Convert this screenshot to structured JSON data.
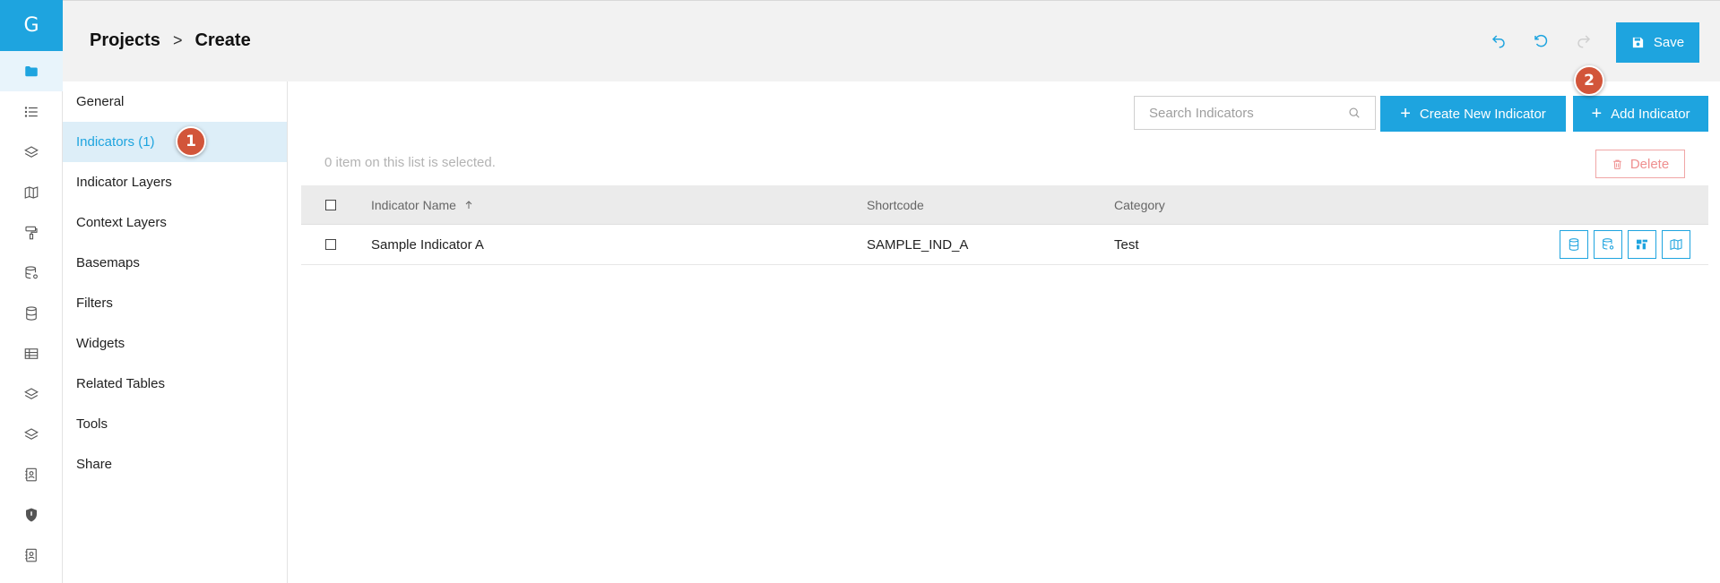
{
  "rail": {
    "logo": "G",
    "items": [
      {
        "icon": "folder-icon",
        "active": true
      },
      {
        "icon": "list-icon"
      },
      {
        "icon": "layers-icon"
      },
      {
        "icon": "map-icon"
      },
      {
        "icon": "paint-roller-icon"
      },
      {
        "icon": "database-settings-icon"
      },
      {
        "icon": "database-icon"
      },
      {
        "icon": "table-icon"
      },
      {
        "icon": "layers-icon"
      },
      {
        "icon": "layers-icon"
      },
      {
        "icon": "contact-book-icon"
      },
      {
        "icon": "shield-icon"
      },
      {
        "icon": "contact-book-icon"
      }
    ]
  },
  "header": {
    "breadcrumb": {
      "root": "Projects",
      "separator": ">",
      "current": "Create"
    },
    "save_label": "Save",
    "icons": [
      "undo-icon",
      "revert-icon",
      "redo-icon"
    ]
  },
  "submenu": {
    "items": [
      {
        "label": "General"
      },
      {
        "label": "Indicators (1)",
        "active": true,
        "badge": "1"
      },
      {
        "label": "Indicator Layers"
      },
      {
        "label": "Context Layers"
      },
      {
        "label": "Basemaps"
      },
      {
        "label": "Filters"
      },
      {
        "label": "Widgets"
      },
      {
        "label": "Related Tables"
      },
      {
        "label": "Tools"
      },
      {
        "label": "Share"
      }
    ]
  },
  "main": {
    "search": {
      "placeholder": "Search Indicators"
    },
    "create_new_label": "Create New Indicator",
    "add_label": "Add Indicator",
    "add_badge": "2",
    "selection_info": "0 item on this list is selected.",
    "delete_label": "Delete",
    "table": {
      "headers": {
        "name": "Indicator Name",
        "shortcode": "Shortcode",
        "category": "Category"
      },
      "rows": [
        {
          "name": "Sample Indicator A",
          "shortcode": "SAMPLE_IND_A",
          "category": "Test"
        }
      ]
    }
  },
  "colors": {
    "accent": "#1ea4df",
    "badge": "#d2553a",
    "danger": "#ef8f8f"
  }
}
